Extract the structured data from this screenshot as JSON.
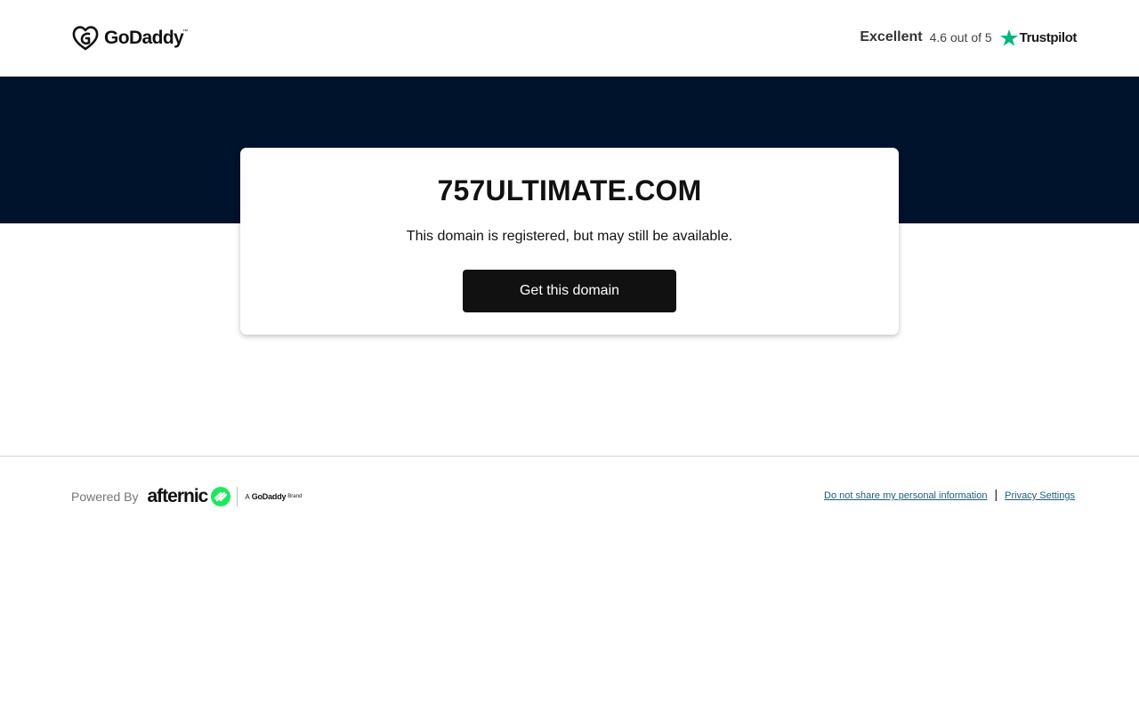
{
  "header": {
    "logo_text": "GoDaddy",
    "logo_tm": "™",
    "rating": {
      "word": "Excellent",
      "score": "4.6 out of 5",
      "provider": "Trustpilot",
      "star_color": "#00b67a"
    }
  },
  "hero": {
    "background": "#00132c"
  },
  "card": {
    "domain": "757ULTIMATE.COM",
    "status": "This domain is registered, but may still be available.",
    "button_label": "Get this domain"
  },
  "footer": {
    "powered_by": "Powered By",
    "brand": {
      "name": "afternic",
      "accent": "#1ce85a",
      "sub_prefix": "A",
      "sub_brand": "GoDaddy",
      "sub_suffix": "Brand"
    },
    "links": [
      {
        "label": "Do not share my personal information"
      },
      {
        "label": "Privacy Settings"
      }
    ],
    "separator": "|"
  }
}
